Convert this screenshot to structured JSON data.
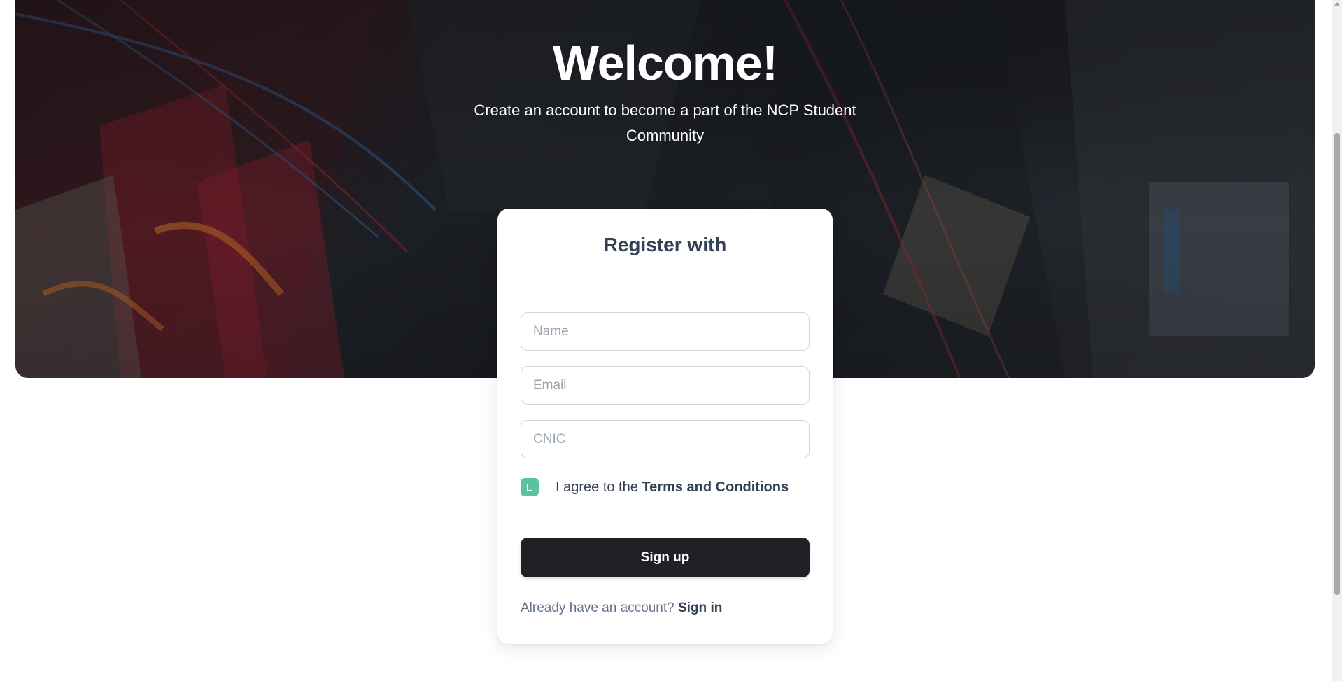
{
  "hero": {
    "title": "Welcome!",
    "subtitle": "Create an account to become a part of the NCP Student Community"
  },
  "card": {
    "title": "Register with",
    "fields": {
      "name_placeholder": "Name",
      "email_placeholder": "Email",
      "cnic_placeholder": "CNIC"
    },
    "terms": {
      "prefix": "I agree to the",
      "link": "Terms and Conditions",
      "checked": true
    },
    "signup_label": "Sign up",
    "signin": {
      "prompt": "Already have an account?",
      "link": "Sign in"
    }
  },
  "colors": {
    "checkbox": "#5bc2a0",
    "button": "#1f2126",
    "heading": "#334155"
  }
}
